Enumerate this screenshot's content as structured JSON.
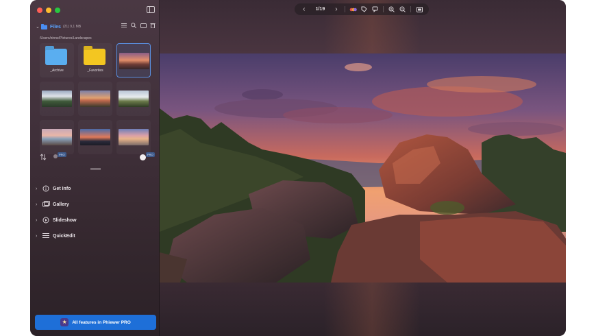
{
  "app": {
    "name": "Phiewer"
  },
  "colors": {
    "accent": "#1e6fd8",
    "files_title": "#5aa2ff",
    "selection": "#5a8fe0",
    "pro_badge": "#3e5a8a"
  },
  "toolbar": {
    "prev_icon": "chevron-left-icon",
    "page_counter": "1/19",
    "next_icon": "chevron-right-icon",
    "tag_icon": "tag-icon",
    "comment_icon": "comment-icon",
    "zoom_in_icon": "zoom-in-icon",
    "zoom_out_icon": "zoom-out-icon",
    "info_icon": "info-panel-icon"
  },
  "files": {
    "title": "Files",
    "info": "(21) 9,1 MB",
    "path": "/Users/zinne/Pictures/Landscapes"
  },
  "grid": {
    "items": [
      {
        "type": "folder",
        "label": "_Archive",
        "color": "#5aaef0"
      },
      {
        "type": "folder",
        "label": "_Favorites",
        "color": "#f3c621"
      },
      {
        "type": "image",
        "label": "",
        "selected": true
      },
      {
        "type": "image",
        "label": ""
      },
      {
        "type": "image",
        "label": ""
      },
      {
        "type": "image",
        "label": ""
      },
      {
        "type": "image",
        "label": ""
      },
      {
        "type": "image",
        "label": ""
      },
      {
        "type": "image",
        "label": ""
      }
    ]
  },
  "controls": {
    "pro_badge_left": "PRO",
    "pro_badge_right": "PRO"
  },
  "sections": [
    {
      "label": "Get Info",
      "icon": "info-circle-icon"
    },
    {
      "label": "Gallery",
      "icon": "gallery-icon"
    },
    {
      "label": "Slideshow",
      "icon": "play-circle-icon"
    },
    {
      "label": "QuickEdit",
      "icon": "sliders-icon"
    }
  ],
  "pro_button": {
    "label": "All features in Phiewer PRO"
  }
}
